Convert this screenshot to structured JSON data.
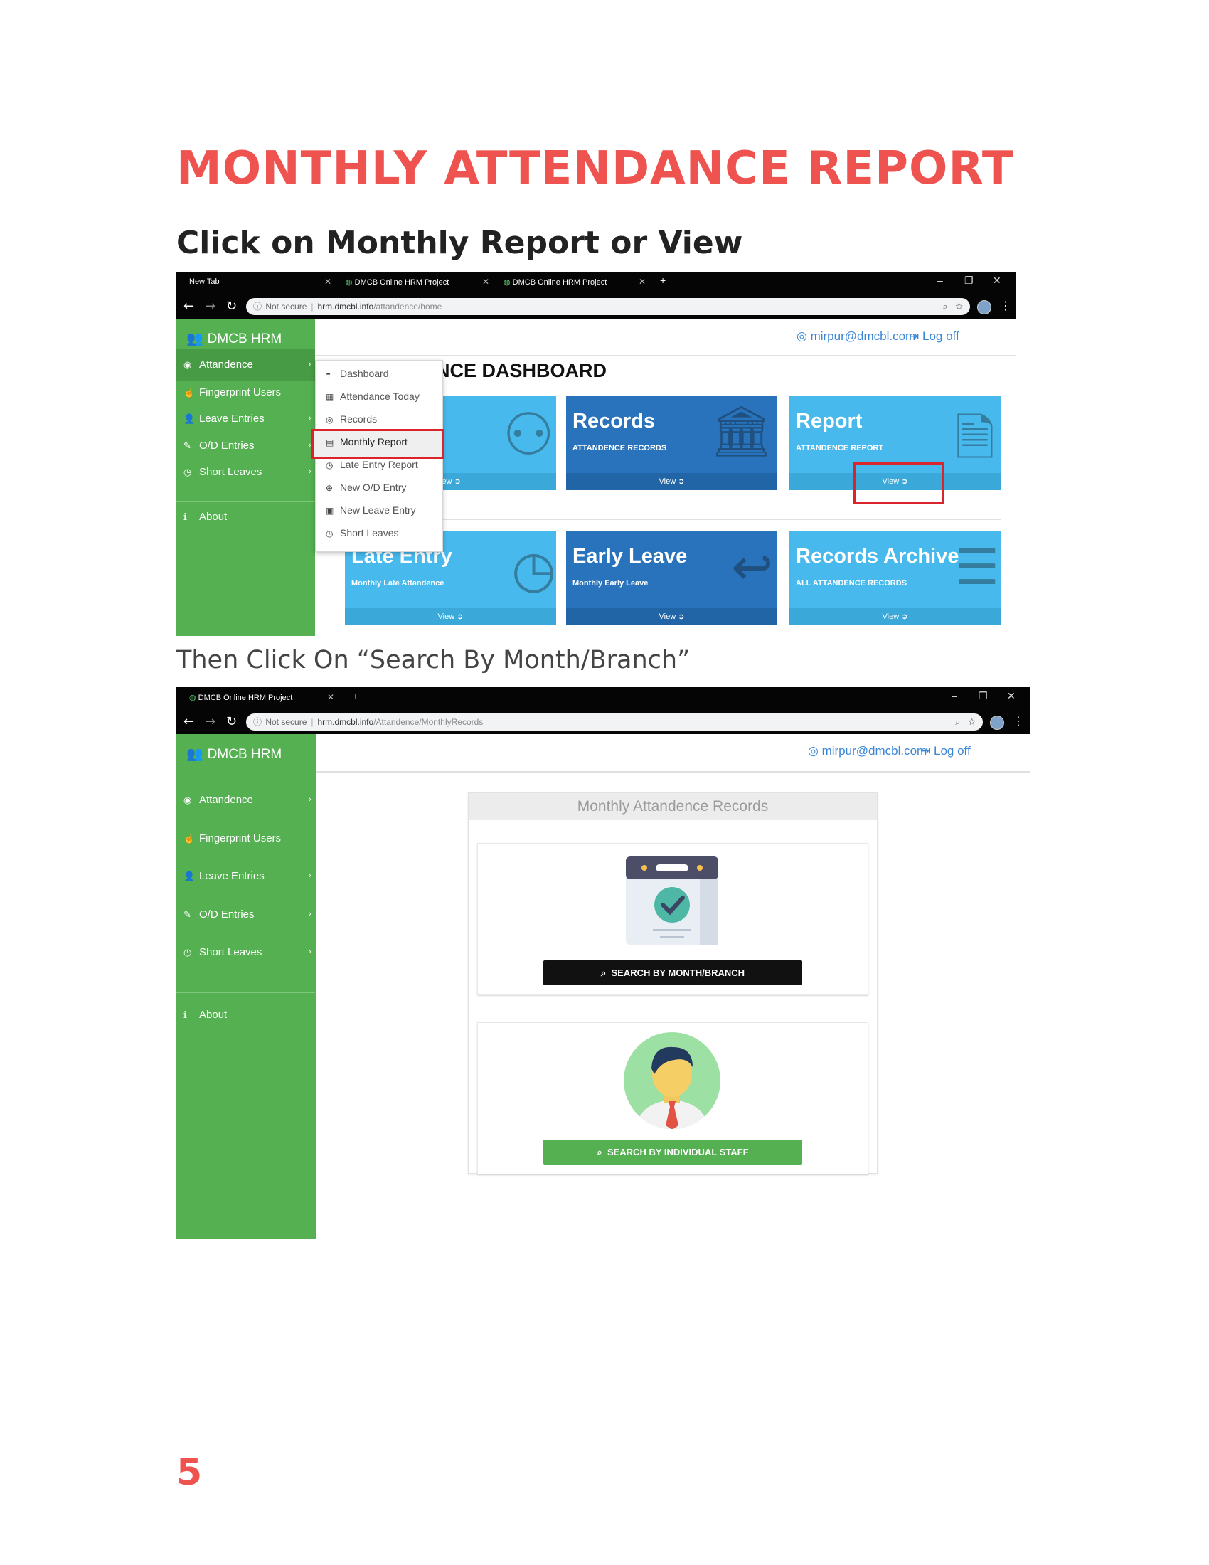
{
  "document": {
    "title": "MONTHLY ATTENDANCE REPORT",
    "step1_heading": "Click on Monthly Report or View",
    "step2_text": "Then Click On “Search By Month/Branch”",
    "page_number": "5"
  },
  "shot1": {
    "tabs": [
      {
        "label": "New Tab"
      },
      {
        "label": "DMCB Online HRM Project"
      },
      {
        "label": "DMCB Online HRM Project"
      }
    ],
    "url": {
      "security": "Not secure",
      "host": "hrm.dmcbl.info",
      "path": "/attandence/home"
    },
    "brand": "DMCB HRM",
    "user_email": "mirpur@dmcbl.com",
    "logoff": "Log off",
    "sidebar": [
      {
        "label": "Attandence",
        "icon": "circle-arrow-icon"
      },
      {
        "label": "Fingerprint Users",
        "icon": "hand-icon"
      },
      {
        "label": "Leave Entries",
        "icon": "user-remove-icon"
      },
      {
        "label": "O/D Entries",
        "icon": "edit-icon"
      },
      {
        "label": "Short Leaves",
        "icon": "clock-icon"
      },
      {
        "label": "About",
        "icon": "info-icon"
      }
    ],
    "dropdown": [
      {
        "label": "Dashboard",
        "icon": "dashboard-icon"
      },
      {
        "label": "Attendance Today",
        "icon": "calendar-icon"
      },
      {
        "label": "Records",
        "icon": "user-circle-icon"
      },
      {
        "label": "Monthly Report",
        "icon": "file-icon",
        "highlighted": true
      },
      {
        "label": "Late Entry Report",
        "icon": "clock-icon"
      },
      {
        "label": "New O/D Entry",
        "icon": "plus-circle-icon"
      },
      {
        "label": "New Leave Entry",
        "icon": "calendar-plus-icon"
      },
      {
        "label": "Short Leaves",
        "icon": "clock-icon"
      }
    ],
    "dashboard_title": "NCE DASHBOARD",
    "tiles": [
      {
        "title": "",
        "subtitle": "",
        "footer": "iew",
        "style": "light",
        "icon": "accessibility-icon"
      },
      {
        "title": "Records",
        "subtitle": "ATTANDENCE RECORDS",
        "footer": "View",
        "style": "dark",
        "icon": "bank-icon"
      },
      {
        "title": "Report",
        "subtitle": "ATTANDENCE REPORT",
        "footer": "View",
        "style": "light",
        "icon": "document-icon"
      },
      {
        "title": "Late Entry",
        "subtitle": "Monthly Late Attandence",
        "footer": "View",
        "style": "light",
        "icon": "clock-icon"
      },
      {
        "title": "Early Leave",
        "subtitle": "Monthly Early Leave",
        "footer": "View",
        "style": "dark",
        "icon": "reply-all-icon"
      },
      {
        "title": "Records Archive",
        "subtitle": "ALL ATTANDENCE RECORDS",
        "footer": "View",
        "style": "light",
        "icon": "database-icon"
      }
    ],
    "colors": {
      "sidebar": "#54b051",
      "tile_light": "#47b9ec",
      "tile_dark": "#2873bb",
      "highlight": "#d9232d"
    }
  },
  "shot2": {
    "tabs": [
      {
        "label": "DMCB Online HRM Project"
      }
    ],
    "url": {
      "security": "Not secure",
      "host": "hrm.dmcbl.info",
      "path": "/Attandence/MonthlyRecords"
    },
    "brand": "DMCB HRM",
    "user_email": "mirpur@dmcbl.com",
    "logoff": "Log off",
    "sidebar": [
      {
        "label": "Attandence",
        "icon": "circle-arrow-icon"
      },
      {
        "label": "Fingerprint Users",
        "icon": "hand-icon"
      },
      {
        "label": "Leave Entries",
        "icon": "user-remove-icon"
      },
      {
        "label": "O/D Entries",
        "icon": "edit-icon"
      },
      {
        "label": "Short Leaves",
        "icon": "clock-icon"
      },
      {
        "label": "About",
        "icon": "info-icon"
      }
    ],
    "panel_title": "Monthly Attandence Records",
    "btn_month": "SEARCH BY MONTH/BRANCH",
    "btn_staff": "SEARCH BY INDIVIDUAL STAFF"
  }
}
